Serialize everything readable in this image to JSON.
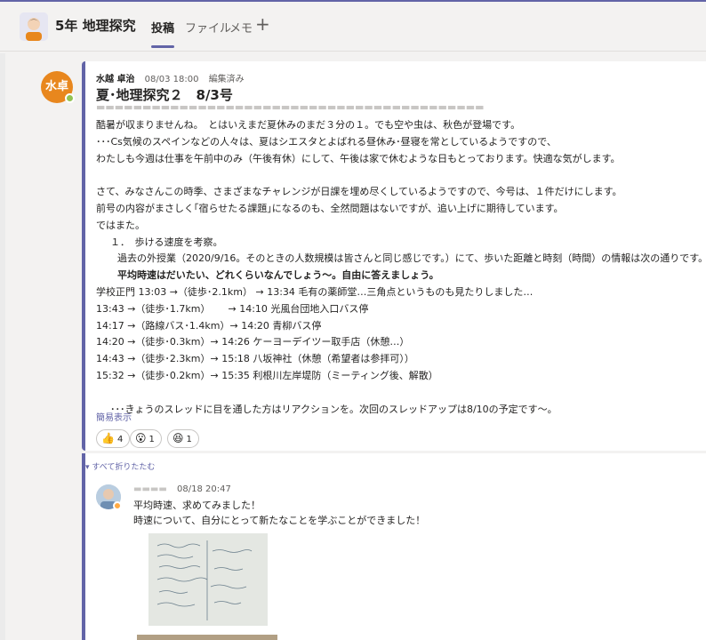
{
  "header": {
    "team_name": "5年 地理探究",
    "tabs": [
      {
        "label": "投稿",
        "active": true
      },
      {
        "label": "ファイル",
        "active": false
      },
      {
        "label": "メモ",
        "active": false
      }
    ],
    "add_tab_icon": "plus-icon"
  },
  "post": {
    "avatar_text": "水卓",
    "author": "水越 卓治",
    "time": "08/03 18:00",
    "edited": "編集済み",
    "subject": "夏･地理探究２　8/3号",
    "lines": [
      "酷暑が収まりませんね。　とはいえまだ夏休みのまだ３分の１。でも空や虫は、秋色が登場です。",
      "･･･Cs気候のスペインなどの人々は、夏はシエスタとよばれる昼休み･昼寝を常としているようですので、",
      "わたしも今週は仕事を午前中のみ（午後有休）にして、午後は家で休むような日もとっております。快適な気がします。",
      "",
      "さて、みなさんこの時季、さまざまなチャレンジが日課を埋め尽くしているようですので、今号は、１件だけにします。",
      "前号の内容がまさしく｢宿らせたる課題｣になるのも、全然問題はないですが、追い上げに期待しています。",
      "ではまた。",
      "１．　歩ける速度を考察。",
      "過去の外授業（2020/9/16。そのときの人数規模は皆さんと同じ感じです。）にて、歩いた距離と時刻（時間）の情報は次の通りです。",
      "平均時速はだいたい、どれくらいなんでしょう〜。自由に答えましょう。",
      "学校正門 13:03 →（徒歩･2.1km） → 13:34 毛有の薬師堂…三角点というものも見たりしました…",
      "13:43 →（徒歩･1.7km）　　 → 14:10 光風台団地入口バス停",
      "14:17 →（路線バス･1.4km）→ 14:20 青柳バス停",
      "14:20 →（徒歩･0.3km）→ 14:26 ケーヨーデイツー取手店（休憩…）",
      "14:43 →（徒歩･2.3km）→ 15:18 八坂神社（休憩（希望者は参拝可））",
      "15:32 →（徒歩･0.2km）→ 15:35 利根川左岸堤防（ミーティング後、解散）",
      "",
      "･･･きょうのスレッドに目を通した方はリアクションを。次回のスレッドアップは8/10の予定です〜。"
    ],
    "show_less": "簡易表示",
    "reactions": [
      {
        "icon": "thumbs-up-icon",
        "glyph": "👍",
        "count": "4"
      },
      {
        "icon": "surprised-face-icon",
        "glyph": "😮",
        "count": "1"
      },
      {
        "icon": "laughing-face-icon",
        "glyph": "😆",
        "count": "1"
      }
    ]
  },
  "thread": {
    "collapse_all": "すべて折りたたむ",
    "reply": {
      "time": "08/18 20:47",
      "lines": [
        "平均時速、求めてみました！",
        "時速について、自分にとって新たなことを学ぶことができました！"
      ]
    }
  },
  "colors": {
    "accent": "#6264a7",
    "avatar_orange": "#e8871e",
    "presence_available": "#92c353",
    "presence_away": "#ffaa44"
  }
}
